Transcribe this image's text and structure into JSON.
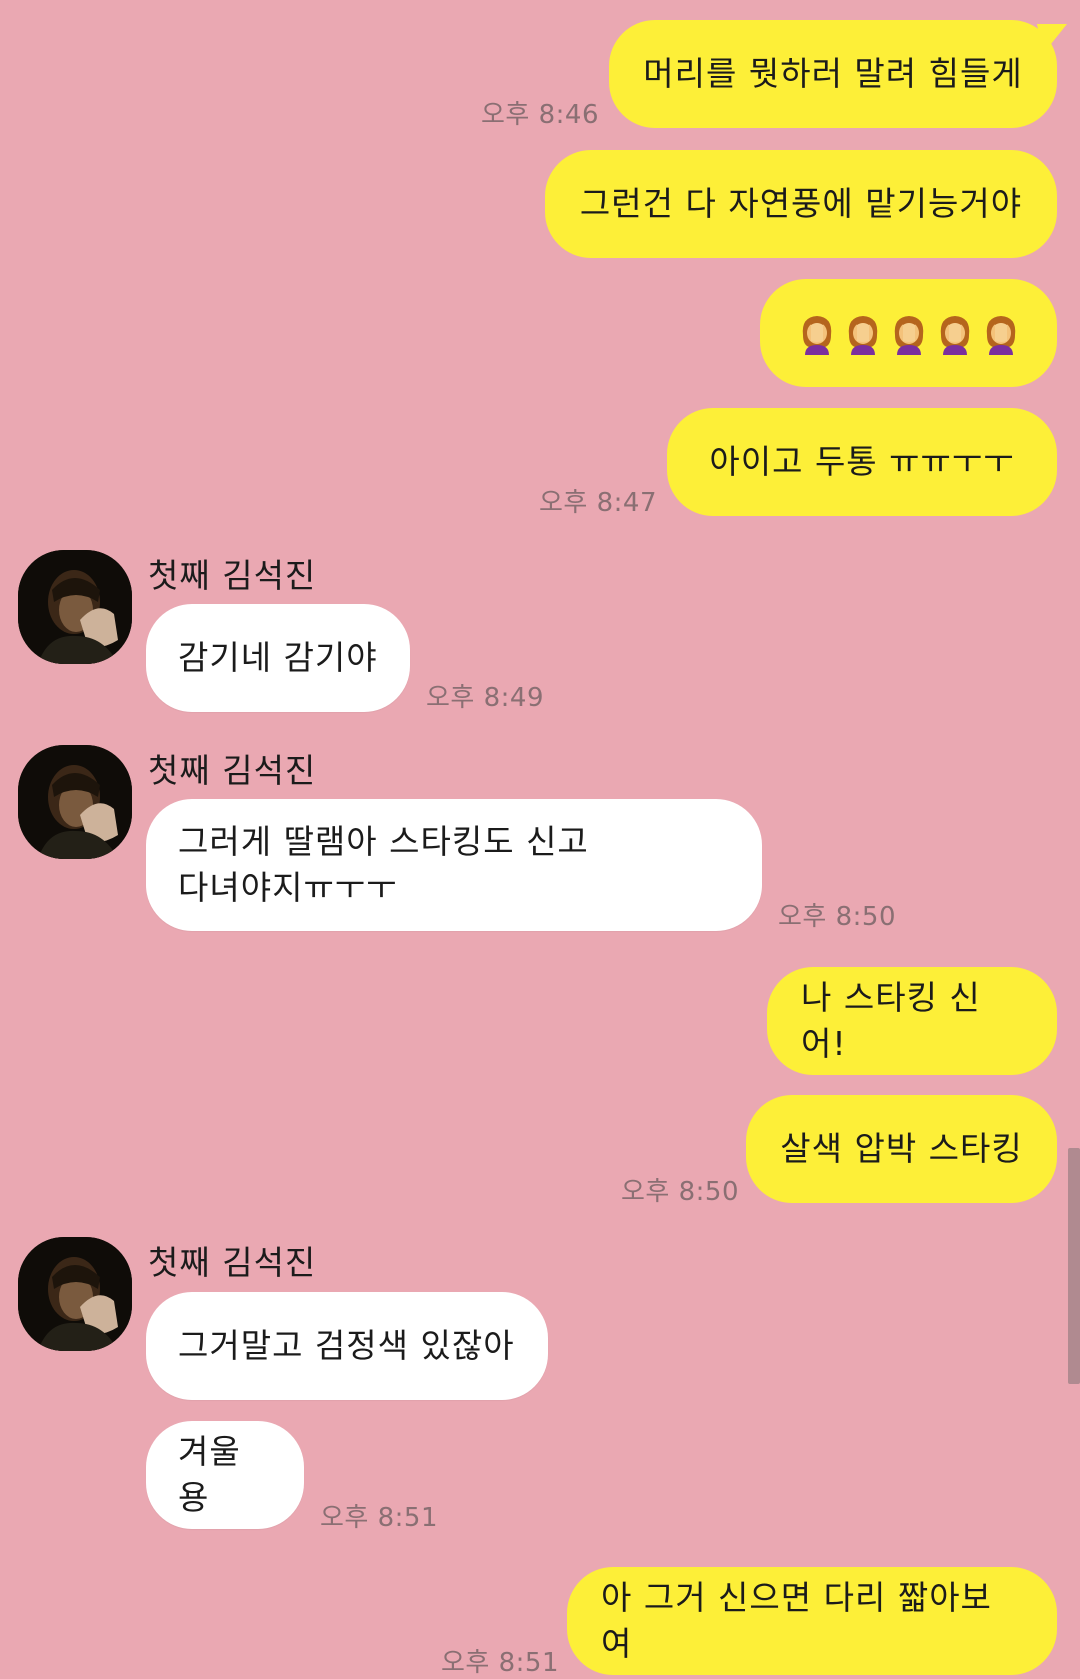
{
  "chat": {
    "sender_name": "첫째 김석진",
    "messages": [
      {
        "side": "me",
        "text": "머리를 뭣하러 말려 힘들게"
      },
      {
        "side": "me",
        "text": "그런건 다 자연풍에 맡기능거야",
        "time": "오후 8:46"
      },
      {
        "side": "me",
        "emoji": "face-palm-woman x5"
      },
      {
        "side": "me",
        "text": "아이고 두통 ㅠㅠㅜㅜ",
        "time": "오후 8:47"
      },
      {
        "side": "them",
        "text": "감기네 감기야",
        "time": "오후 8:49"
      },
      {
        "side": "them",
        "text_line1": "그러게 딸램아 스타킹도 신고",
        "text_line2": "다녀야지ㅠㅜㅜ",
        "time": "오후 8:50"
      },
      {
        "side": "me",
        "text": "나 스타킹 신어!"
      },
      {
        "side": "me",
        "text": "살색 압박 스타킹",
        "time": "오후 8:50"
      },
      {
        "side": "them",
        "text": "그거말고 검정색 있잖아"
      },
      {
        "side": "them",
        "text": "겨울용",
        "time": "오후 8:51"
      },
      {
        "side": "me",
        "text": "아 그거 신으면 다리 짧아보여",
        "time": "오후 8:51"
      }
    ]
  },
  "colors": {
    "background": "#eaa8b2",
    "my_bubble": "#fdef38",
    "their_bubble": "#ffffff",
    "time_text": "#8a6f73"
  },
  "icons": {
    "avatar": "profile-photo",
    "emoji": "woman-facepalming"
  }
}
